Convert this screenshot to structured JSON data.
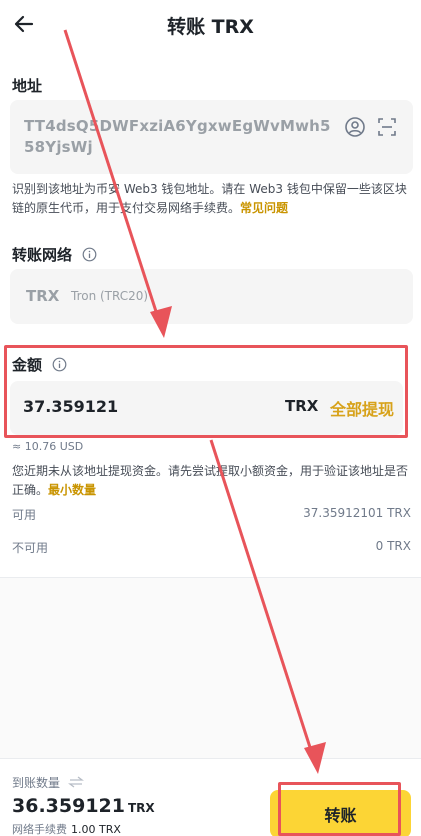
{
  "header": {
    "title": "转账 TRX"
  },
  "address": {
    "label": "地址",
    "value": "TT4dsQ5DWFxziA6YgxwEgWvMwh558YjsWj",
    "note": "识别到该地址为币安 Web3 钱包地址。请在 Web3 钱包中保留一些该区块链的原生代币，用于支付交易网络手续费。",
    "note_link": "常见问题"
  },
  "network": {
    "label": "转账网络",
    "symbol": "TRX",
    "name": "Tron (TRC20)"
  },
  "amount": {
    "label": "金额",
    "value": "37.359121",
    "unit": "TRX",
    "max_label": "全部提现",
    "usd": "≈ 10.76 USD",
    "warning": "您近期未从该地址提现资金。请先尝试提取小额资金，用于验证该地址是否正确。",
    "warning_link": "最小数量"
  },
  "balances": {
    "available_label": "可用",
    "available_value": "37.35912101 TRX",
    "unavailable_label": "不可用",
    "unavailable_value": "0 TRX"
  },
  "footer": {
    "receive_label": "到账数量",
    "receive_value": "36.359121",
    "receive_unit": "TRX",
    "fee_label": "网络手续费",
    "fee_value": "1.00 TRX",
    "submit_label": "转账"
  },
  "colors": {
    "accent": "#fcd535",
    "link": "#c99400",
    "annotation": "#e8545a"
  }
}
